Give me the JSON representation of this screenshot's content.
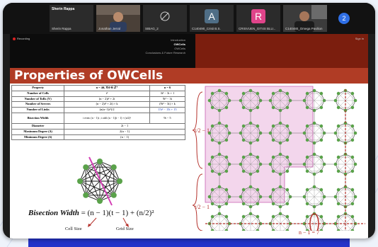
{
  "meeting": {
    "participants": [
      {
        "name": "Sherin Rappa",
        "caption": "Sherin Rappa",
        "kind": "text"
      },
      {
        "name": "Jonathan Jerral",
        "kind": "video"
      },
      {
        "name": "SIBAG_2",
        "kind": "icon",
        "icon": "camera-off-icon"
      },
      {
        "name": "C140490_Cristi B.S.",
        "avatar": "A",
        "avatar_color": "#4f6e86",
        "kind": "avatar"
      },
      {
        "name": "CRISVUEN_GIT4S BLU...",
        "avatar": "R",
        "avatar_color": "#e0448a",
        "kind": "avatar"
      },
      {
        "name": "C140480_Omega Pavilion",
        "kind": "video"
      }
    ],
    "more_count": "2"
  },
  "slide": {
    "recording": "Recording",
    "nav": [
      "Introduction",
      "OWCells",
      "OWCells",
      "Conclusions & Future Research"
    ],
    "nav_active_index": 1,
    "sign_in": "Sign in",
    "title": "Properties of OWCells",
    "table": {
      "headers": [
        "Property",
        "n = 4d, ∀d ∈ ℤ⁺",
        "n = 6"
      ],
      "rows": [
        [
          "Number of Cells",
          "t²",
          "3t² − 3t + 1"
        ],
        [
          "Number of ToRs (V)",
          "(n − 2)t² + 2t",
          "9t² − 3t"
        ],
        [
          "Number of Servers",
          "(n − 2)t² + 2t) × k",
          "(9t² − 3t) × k"
        ],
        [
          "Number of Links",
          "(n(n−1)t²)/2",
          "15t² − 15t + 15"
        ],
        [
          "Bisection Width",
          "t even: (n − 1)t ; t odd: (n − 1)(t − 1) + (n/2)²",
          "9t − 5"
        ],
        [
          "Diameter",
          "2t − 1",
          ""
        ],
        [
          "Maximum Degree (Δ)",
          "2(n − 1)",
          ""
        ],
        [
          "Minimum Degree (δ)",
          "(n − 1)",
          ""
        ]
      ]
    },
    "formula": {
      "lhs": "Bisection Width",
      "rhs": "= (n − 1)(t − 1) + (n/2)²",
      "label_left": "Cell Size",
      "label_right": "Grid Size"
    },
    "grid_labels": {
      "top": "t/2 − 1",
      "bottom": "t/2 − 1",
      "count": "n − 1 = 7"
    }
  }
}
